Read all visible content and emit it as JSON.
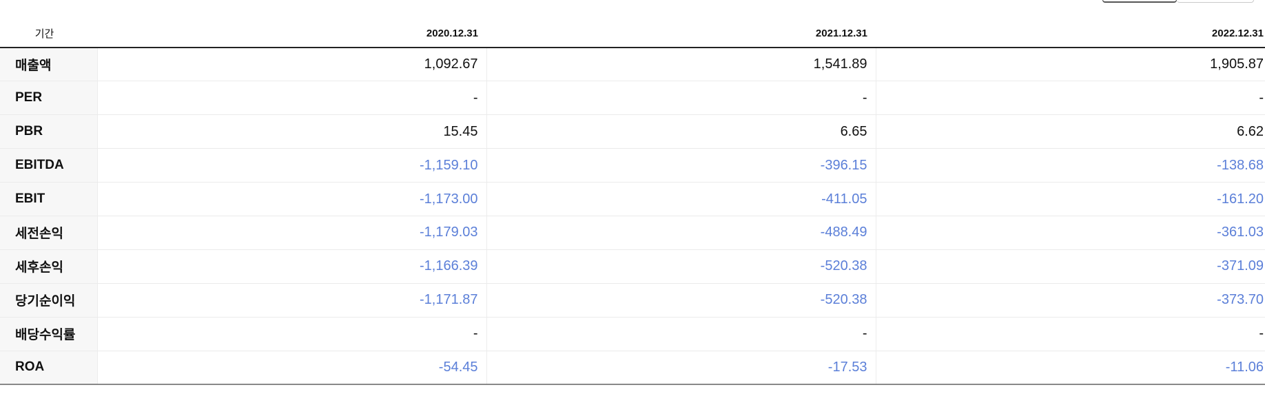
{
  "header": {
    "period_label": "기간",
    "periods": [
      "2020.12.31",
      "2021.12.31",
      "2022.12.31"
    ]
  },
  "rows": [
    {
      "label": "매출액",
      "values": [
        "1,092.67",
        "1,541.89",
        "1,905.87"
      ]
    },
    {
      "label": "PER",
      "values": [
        "-",
        "-",
        "-"
      ]
    },
    {
      "label": "PBR",
      "values": [
        "15.45",
        "6.65",
        "6.62"
      ]
    },
    {
      "label": "EBITDA",
      "values": [
        "-1,159.10",
        "-396.15",
        "-138.68"
      ]
    },
    {
      "label": "EBIT",
      "values": [
        "-1,173.00",
        "-411.05",
        "-161.20"
      ]
    },
    {
      "label": "세전손익",
      "values": [
        "-1,179.03",
        "-488.49",
        "-361.03"
      ]
    },
    {
      "label": "세후손익",
      "values": [
        "-1,166.39",
        "-520.38",
        "-371.09"
      ]
    },
    {
      "label": "당기순이익",
      "values": [
        "-1,171.87",
        "-520.38",
        "-373.70"
      ]
    },
    {
      "label": "배당수익률",
      "values": [
        "-",
        "-",
        "-"
      ]
    },
    {
      "label": "ROA",
      "values": [
        "-54.45",
        "-17.53",
        "-11.06"
      ]
    }
  ],
  "colors": {
    "negative": "#5b7fd8",
    "positive": "#111111",
    "label_bg": "#f7f7f7"
  }
}
